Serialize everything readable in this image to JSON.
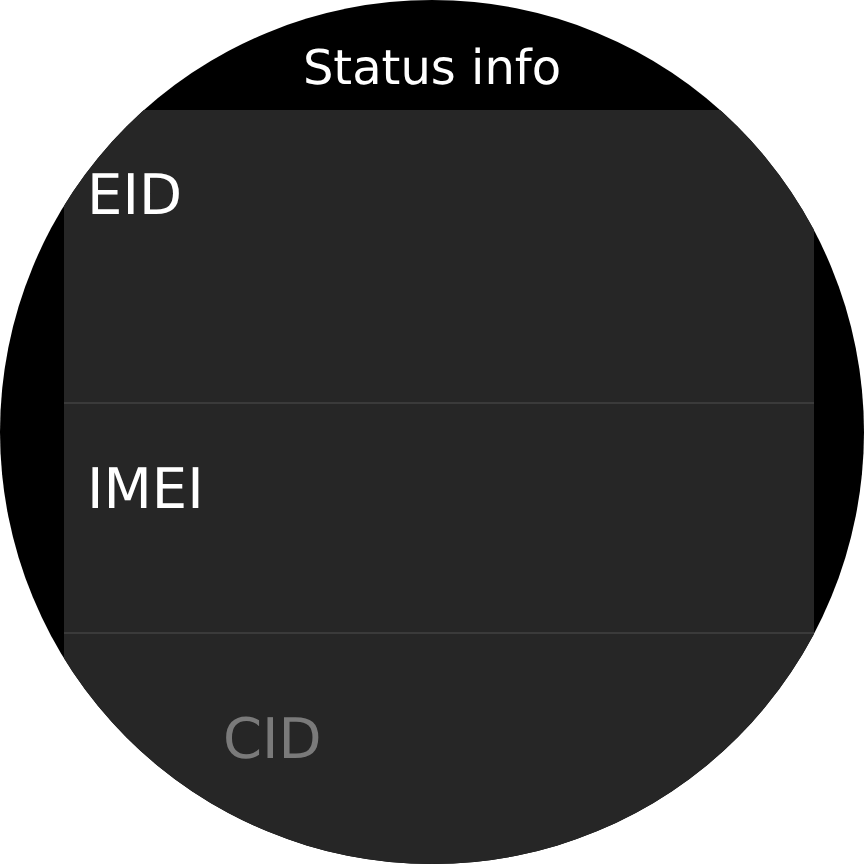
{
  "header": {
    "title": "Status info"
  },
  "items": [
    {
      "label": "EID",
      "dimmed": false
    },
    {
      "label": "IMEI",
      "dimmed": false
    },
    {
      "label": "CID",
      "dimmed": true
    }
  ]
}
